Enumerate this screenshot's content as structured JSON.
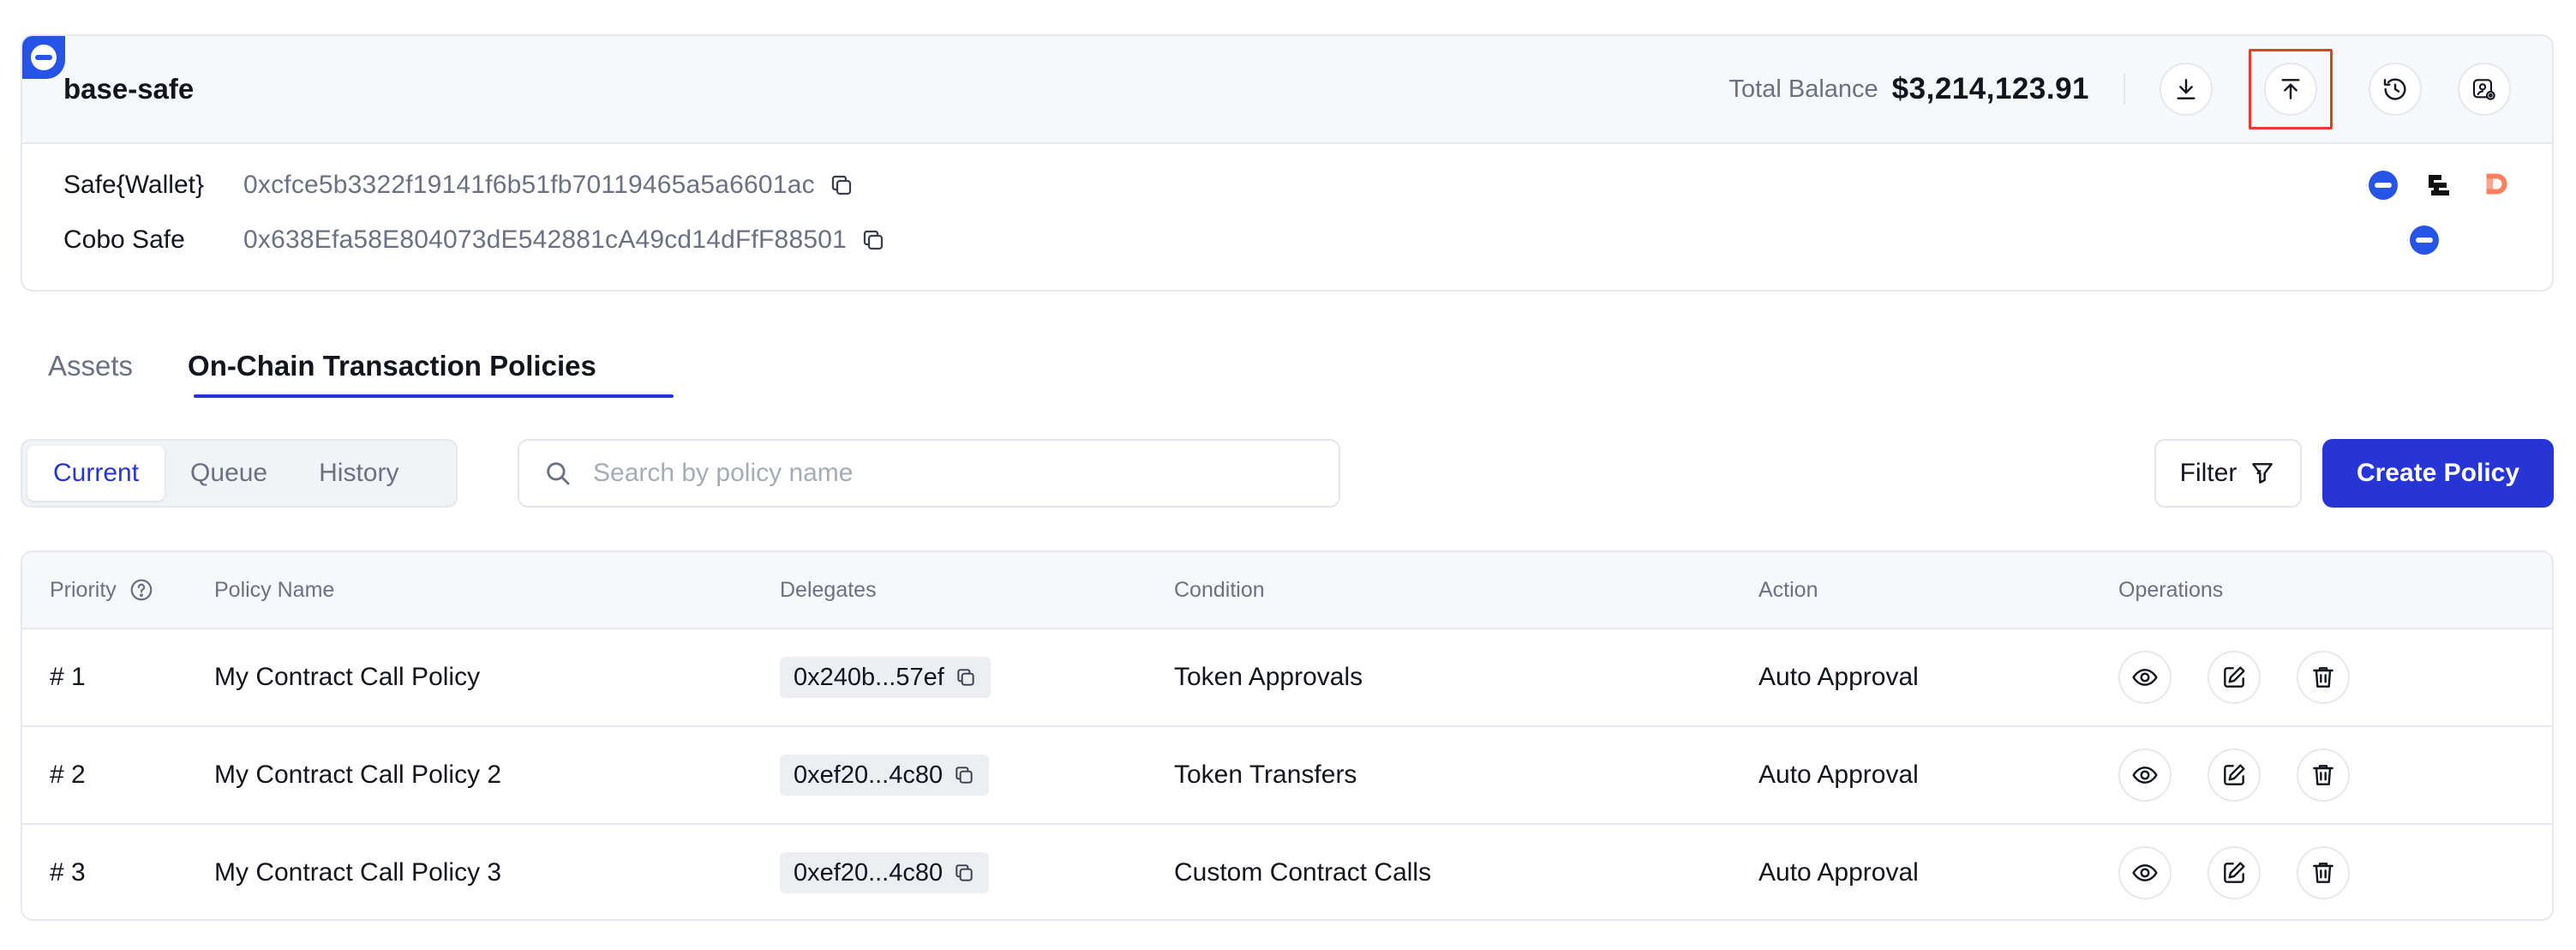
{
  "safe": {
    "name": "base-safe",
    "balance_label": "Total Balance",
    "balance_value": "$3,214,123.91",
    "addresses": [
      {
        "label": "Safe{Wallet}",
        "value": "0xcfce5b3322f19141f6b51fb70119465a5a6601ac"
      },
      {
        "label": "Cobo Safe",
        "value": "0x638Efa58E804073dE542881cA49cd14dFfF88501"
      }
    ]
  },
  "header_icons": [
    "download-icon",
    "upload-icon",
    "history-icon",
    "settings-icon"
  ],
  "tabs": {
    "assets": "Assets",
    "policies": "On-Chain Transaction Policies"
  },
  "segments": {
    "current": "Current",
    "queue": "Queue",
    "history": "History"
  },
  "search": {
    "placeholder": "Search by policy name"
  },
  "filter_label": "Filter",
  "create_label": "Create Policy",
  "table": {
    "headers": {
      "priority": "Priority",
      "name": "Policy Name",
      "delegates": "Delegates",
      "condition": "Condition",
      "action": "Action",
      "operations": "Operations"
    },
    "rows": [
      {
        "priority": "# 1",
        "name": "My Contract Call Policy",
        "delegate": "0x240b...57ef",
        "condition": "Token Approvals",
        "action": "Auto Approval"
      },
      {
        "priority": "# 2",
        "name": "My Contract Call Policy 2",
        "delegate": "0xef20...4c80",
        "condition": "Token Transfers",
        "action": "Auto Approval"
      },
      {
        "priority": "# 3",
        "name": "My Contract Call Policy 3",
        "delegate": "0xef20...4c80",
        "condition": "Custom Contract Calls",
        "action": "Auto Approval"
      }
    ]
  },
  "colors": {
    "accent": "#2734d6",
    "brand": "#2754e8",
    "highlight": "#e53c2c",
    "border": "#e6e8ee"
  }
}
